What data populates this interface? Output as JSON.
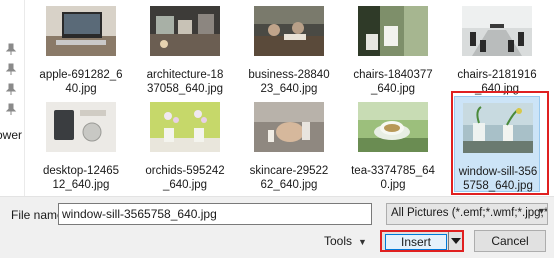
{
  "nav": {
    "fragment_text": "ower"
  },
  "files": [
    {
      "name": "apple-691282_6\n40.jpg",
      "selected": false
    },
    {
      "name": "architecture-18\n37058_640.jpg",
      "selected": false
    },
    {
      "name": "business-28840\n23_640.jpg",
      "selected": false
    },
    {
      "name": "chairs-1840377\n_640.jpg",
      "selected": false
    },
    {
      "name": "chairs-2181916\n_640.jpg",
      "selected": false
    },
    {
      "name": "desktop-12465\n12_640.jpg",
      "selected": false
    },
    {
      "name": "orchids-595242\n_640.jpg",
      "selected": false
    },
    {
      "name": "skincare-29522\n62_640.jpg",
      "selected": false
    },
    {
      "name": "tea-3374785_64\n0.jpg",
      "selected": false
    },
    {
      "name": "window-sill-356\n5758_640.jpg",
      "selected": true
    }
  ],
  "bottom_bar": {
    "file_name_label": "File name:",
    "file_name_value": "window-sill-3565758_640.jpg",
    "file_type_value": "All Pictures (*.emf;*.wmf;*.jpg;*",
    "tools_label": "Tools",
    "insert_label": "Insert",
    "cancel_label": "Cancel"
  },
  "colors": {
    "selection_fill": "#cce4f7",
    "selection_border": "#99c9ef",
    "highlight_red": "#e02020",
    "insert_focus": "#0078d7"
  },
  "icons": {
    "pin": "pin-icon",
    "chevron": "chevron-down-icon"
  }
}
